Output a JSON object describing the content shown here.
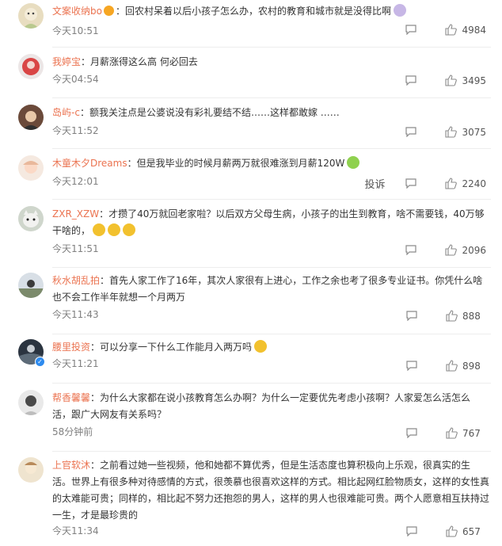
{
  "colors": {
    "username": "#eb7350",
    "text": "#333333",
    "meta": "#808080",
    "divider": "#ededed"
  },
  "actions": {
    "report_label": "投诉",
    "reply_icon": "comment-icon",
    "like_icon": "thumb-up-icon"
  },
  "comments": [
    {
      "user": "文案收纳bo",
      "sep": "：",
      "text": "回农村呆着以后小孩子怎么办，农村的教育和城市就是没得比啊",
      "time": "今天10:51",
      "likes": "4984"
    },
    {
      "user": "我婷宝",
      "sep": "：",
      "text": "月薪涨得这么高 何必回去",
      "time": "今天04:54",
      "likes": "3495"
    },
    {
      "user": "岛屿-c",
      "sep": "：",
      "text": "额我关注点是公婆说没有彩礼要结不结……这样都敢嫁 ……",
      "time": "今天11:52",
      "likes": "3075"
    },
    {
      "user": "木童木夕Dreams",
      "sep": "：",
      "text": "但是我毕业的时候月薪两万就很难涨到月薪120W",
      "time": "今天12:01",
      "likes": "2240"
    },
    {
      "user": "ZXR_XZW",
      "sep": "：",
      "text": "才攒了40万就回老家啦？以后双方父母生病，小孩子的出生到教育，啥不需要钱，40万够干啥的，",
      "time": "今天11:51",
      "likes": "2096"
    },
    {
      "user": "秋水胡乱拍",
      "sep": "：",
      "text": "首先人家工作了16年，其次人家很有上进心，工作之余也考了很多专业证书。你凭什么啥也不会工作半年就想一个月两万",
      "time": "今天11:43",
      "likes": "888"
    },
    {
      "user": "腰里投资",
      "sep": "：",
      "text": "可以分享一下什么工作能月入两万吗",
      "time": "今天11:21",
      "likes": "898"
    },
    {
      "user": "帮香馨馨",
      "sep": "：",
      "text": "为什么大家都在说小孩教育怎么办啊？为什么一定要优先考虑小孩啊？人家爱怎么活怎么活，跟广大网友有关系吗？",
      "time": "58分钟前",
      "likes": "767"
    },
    {
      "user": "上官软沐",
      "sep": "：",
      "text": "之前看过她一些视频，他和她都不算优秀，但是生活态度也算积极向上乐观，很真实的生活。世界上有很多种对待感情的方式，很羡慕也很喜欢这样的方式。相比起网红脸物质女，这样的女性真的太难能可贵；同样的，相比起不努力还抱怨的男人，这样的男人也很难能可贵。两个人愿意相互扶持过一生，才是最珍贵的",
      "time": "今天11:34",
      "likes": "657"
    }
  ]
}
